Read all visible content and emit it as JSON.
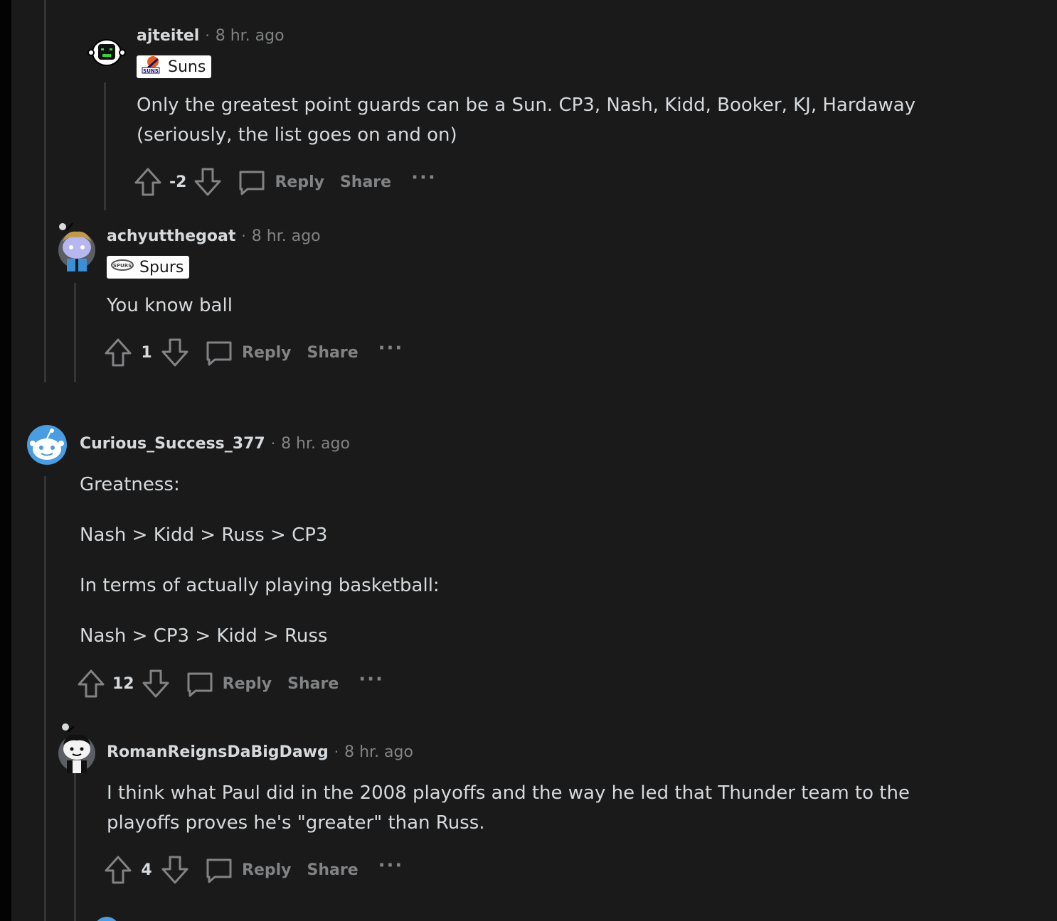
{
  "comments": [
    {
      "username": "ajteitel",
      "sep": "·",
      "time": "8 hr. ago",
      "flair": "Suns",
      "flair_logo": "SUNS",
      "body": [
        "Only the greatest point guards can be a Sun. CP3, Nash, Kidd, Booker, KJ, Hardaway (seriously, the list goes on and on)"
      ],
      "score": "-2",
      "reply": "Reply",
      "share": "Share",
      "more": "···"
    },
    {
      "username": "achyutthegoat",
      "sep": "·",
      "time": "8 hr. ago",
      "flair": "Spurs",
      "flair_logo": "SPURS",
      "body": [
        "You know ball"
      ],
      "score": "1",
      "reply": "Reply",
      "share": "Share",
      "more": "···"
    },
    {
      "username": "Curious_Success_377",
      "sep": "·",
      "time": "8 hr. ago",
      "body": [
        "Greatness:",
        "Nash > Kidd > Russ > CP3",
        "In terms of actually playing basketball:",
        "Nash > CP3 > Kidd > Russ"
      ],
      "score": "12",
      "reply": "Reply",
      "share": "Share",
      "more": "···"
    },
    {
      "username": "RomanReignsDaBigDawg",
      "sep": "·",
      "time": "8 hr. ago",
      "body": [
        "I think what Paul did in the 2008 playoffs and the way he led that Thunder team to the playoffs proves he's \"greater\" than Russ."
      ],
      "score": "4",
      "reply": "Reply",
      "share": "Share",
      "more": "···"
    }
  ],
  "colors": {
    "background": "#1a1a1b",
    "text": "#d7dadc",
    "muted": "#818384",
    "thread_line": "#343536"
  }
}
